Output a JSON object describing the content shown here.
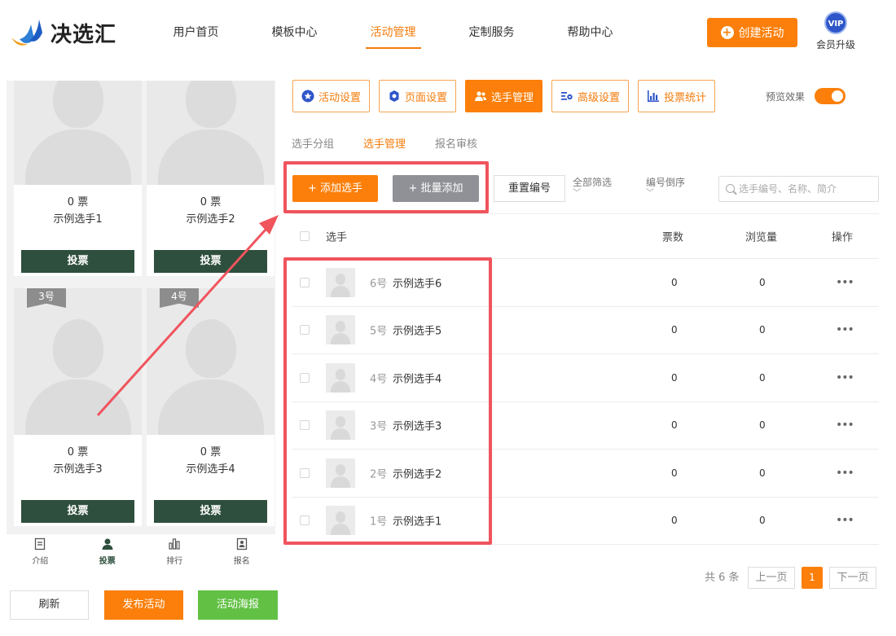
{
  "header": {
    "logo_text": "决选汇",
    "nav": [
      "用户首页",
      "模板中心",
      "活动管理",
      "定制服务",
      "帮助中心"
    ],
    "active_nav": 2,
    "create_button": "创建活动",
    "vip_badge": "VIP",
    "vip_label": "会员升级"
  },
  "preview": {
    "cards": [
      {
        "tag": "",
        "votes": "0 票",
        "name": "示例选手1",
        "vote_label": "投票"
      },
      {
        "tag": "",
        "votes": "0 票",
        "name": "示例选手2",
        "vote_label": "投票"
      },
      {
        "tag": "3号",
        "votes": "0 票",
        "name": "示例选手3",
        "vote_label": "投票"
      },
      {
        "tag": "4号",
        "votes": "0 票",
        "name": "示例选手4",
        "vote_label": "投票"
      }
    ],
    "bottom_nav": [
      {
        "label": "介绍",
        "icon": "document-icon"
      },
      {
        "label": "投票",
        "icon": "user-icon"
      },
      {
        "label": "排行",
        "icon": "bar-chart-icon"
      },
      {
        "label": "报名",
        "icon": "id-card-icon"
      }
    ],
    "active_bottom": 1,
    "refresh_label": "刷新",
    "publish_label": "发布活动",
    "poster_label": "活动海报"
  },
  "tool_tabs": [
    {
      "label": "活动设置",
      "icon": "star-icon"
    },
    {
      "label": "页面设置",
      "icon": "gear-icon"
    },
    {
      "label": "选手管理",
      "icon": "users-icon"
    },
    {
      "label": "高级设置",
      "icon": "settings-list-icon"
    },
    {
      "label": "投票统计",
      "icon": "bar-chart-icon"
    }
  ],
  "active_tool_tab": 2,
  "preview_toggle": {
    "label": "预览效果",
    "on": true
  },
  "sub_tabs": [
    "选手分组",
    "选手管理",
    "报名审核"
  ],
  "active_sub_tab": 1,
  "actions": {
    "add": "添加选手",
    "batch": "批量添加",
    "reset": "重置编号",
    "filter_all": "全部筛选",
    "sort_desc": "编号倒序",
    "search_placeholder": "选手编号、名称、简介"
  },
  "table": {
    "headers": {
      "name": "选手",
      "votes": "票数",
      "views": "浏览量",
      "ops": "操作"
    },
    "rows": [
      {
        "num": "6号",
        "name": "示例选手6",
        "votes": "0",
        "views": "0"
      },
      {
        "num": "5号",
        "name": "示例选手5",
        "votes": "0",
        "views": "0"
      },
      {
        "num": "4号",
        "name": "示例选手4",
        "votes": "0",
        "views": "0"
      },
      {
        "num": "3号",
        "name": "示例选手3",
        "votes": "0",
        "views": "0"
      },
      {
        "num": "2号",
        "name": "示例选手2",
        "votes": "0",
        "views": "0"
      },
      {
        "num": "1号",
        "name": "示例选手1",
        "votes": "0",
        "views": "0"
      }
    ],
    "ops_glyph": "•••"
  },
  "pagination": {
    "total": "共 6 条",
    "prev": "上一页",
    "current": "1",
    "next": "下一页"
  },
  "colors": {
    "accent": "#fb7f0a",
    "dark_green": "#2e4f3d",
    "green": "#62c145",
    "annotation_red": "#f0545d"
  }
}
